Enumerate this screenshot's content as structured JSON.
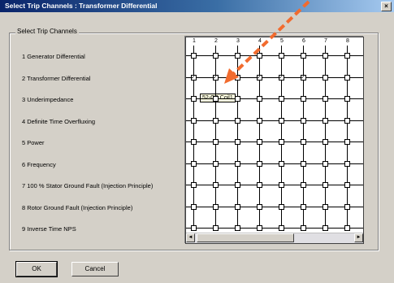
{
  "window": {
    "title": "Select Trip Channels  :  Transformer Differential",
    "close_label": "×"
  },
  "group": {
    "label": "Select Trip Channels"
  },
  "columns": [
    "1",
    "2",
    "3",
    "4",
    "5",
    "6",
    "7",
    "8"
  ],
  "rows": [
    {
      "label": "1   Generator Differential",
      "checked": [
        false,
        false,
        false,
        false,
        false,
        false,
        false,
        false
      ]
    },
    {
      "label": "2   Transformer Differential",
      "checked": [
        true,
        true,
        true,
        true,
        true,
        true,
        false,
        false
      ]
    },
    {
      "label": "3   Underimpedance",
      "checked": [
        false,
        false,
        false,
        false,
        false,
        false,
        false,
        false
      ]
    },
    {
      "label": "4   Definite Time Overfluxing",
      "checked": [
        false,
        false,
        false,
        false,
        false,
        false,
        false,
        false
      ]
    },
    {
      "label": "5   Power",
      "checked": [
        false,
        false,
        false,
        false,
        false,
        false,
        false,
        false
      ]
    },
    {
      "label": "6   Frequency",
      "checked": [
        false,
        false,
        false,
        false,
        false,
        false,
        false,
        false
      ]
    },
    {
      "label": "7   100 %  Stator Ground Fault (Injection Principle)",
      "checked": [
        false,
        false,
        false,
        false,
        false,
        false,
        false,
        false
      ]
    },
    {
      "label": "8   Rotor Ground Fault (Injection Principle)",
      "checked": [
        false,
        false,
        false,
        false,
        false,
        false,
        false,
        false
      ]
    },
    {
      "label": "9   Inverse Time NPS",
      "checked": [
        false,
        false,
        false,
        false,
        false,
        false,
        false,
        false
      ]
    }
  ],
  "tooltip": "52-CB Coil1",
  "buttons": {
    "ok": "OK",
    "cancel": "Cancel"
  },
  "scroll": {
    "left": "◄",
    "right": "►"
  },
  "colors": {
    "arrow": "#f26b2e",
    "title_start": "#0a246a",
    "title_end": "#a6caf0"
  }
}
